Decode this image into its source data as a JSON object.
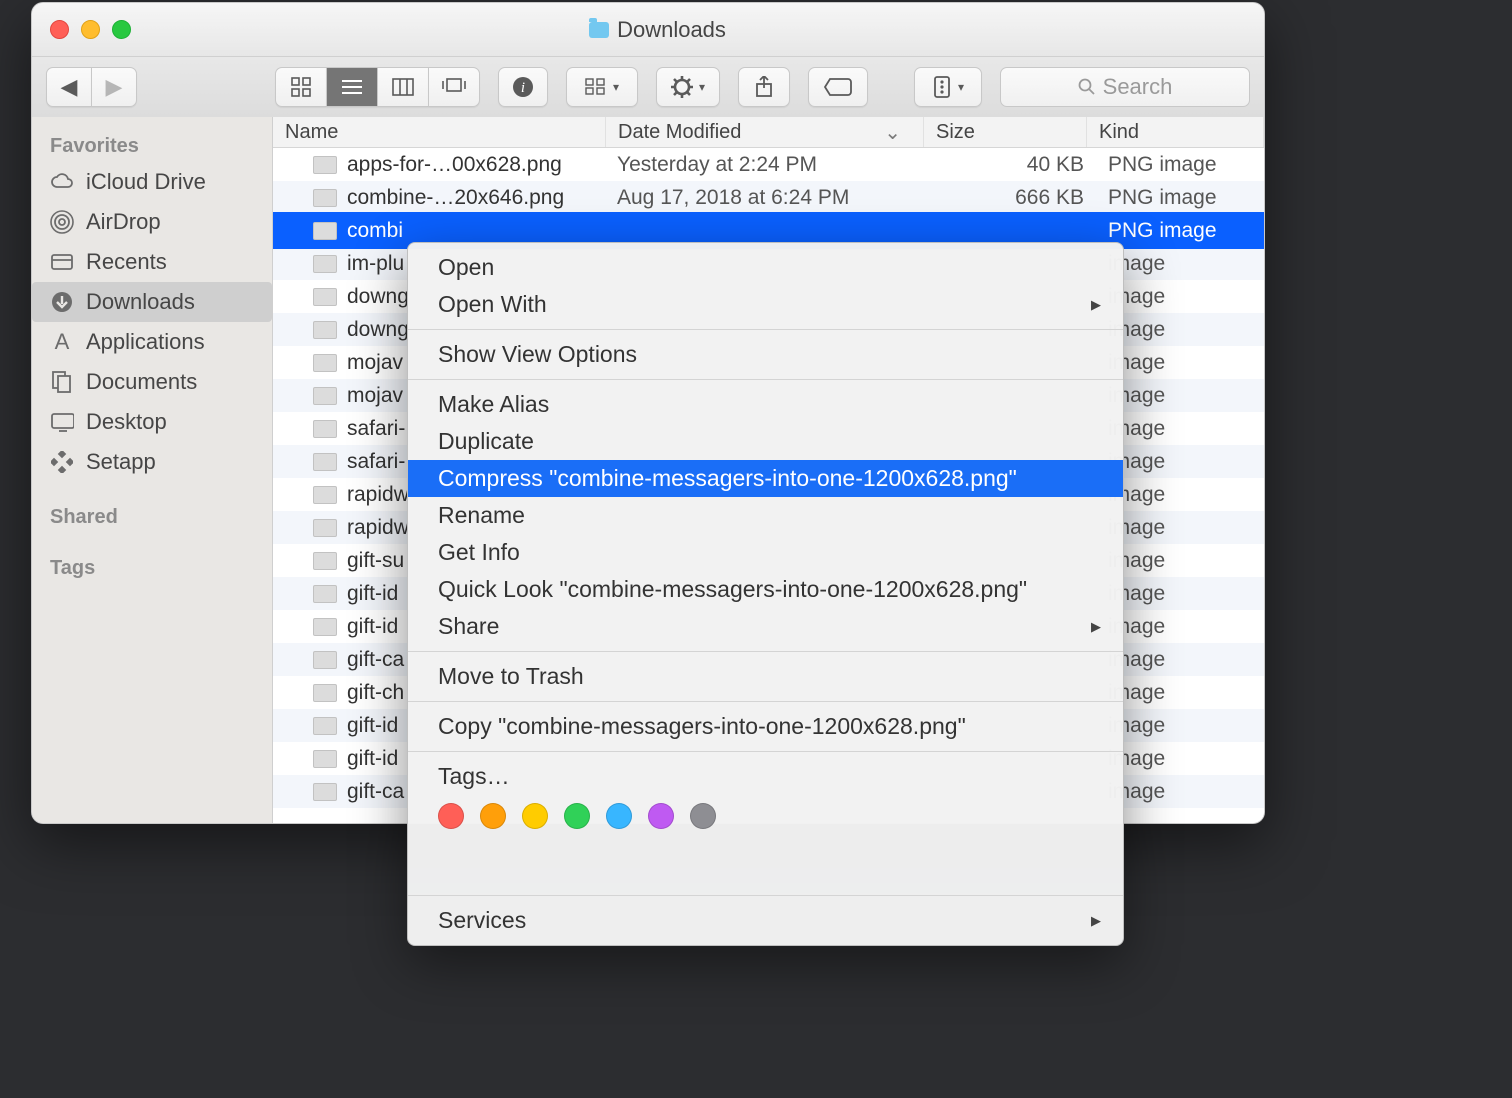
{
  "window": {
    "title": "Downloads"
  },
  "search": {
    "placeholder": "Search"
  },
  "columns": {
    "name": "Name",
    "date": "Date Modified",
    "size": "Size",
    "kind": "Kind"
  },
  "sidebar": {
    "favorites_label": "Favorites",
    "shared_label": "Shared",
    "tags_label": "Tags",
    "items": [
      {
        "label": "iCloud Drive",
        "icon": "cloud"
      },
      {
        "label": "AirDrop",
        "icon": "airdrop"
      },
      {
        "label": "Recents",
        "icon": "recents"
      },
      {
        "label": "Downloads",
        "icon": "downloads",
        "selected": true
      },
      {
        "label": "Applications",
        "icon": "apps"
      },
      {
        "label": "Documents",
        "icon": "docs"
      },
      {
        "label": "Desktop",
        "icon": "desktop"
      },
      {
        "label": "Setapp",
        "icon": "setapp"
      }
    ]
  },
  "rows": [
    {
      "name": "apps-for-…00x628.png",
      "date": "Yesterday at 2:24 PM",
      "size": "40 KB",
      "kind": "PNG image"
    },
    {
      "name": "combine-…20x646.png",
      "date": "Aug 17, 2018 at 6:24 PM",
      "size": "666 KB",
      "kind": "PNG image"
    },
    {
      "name": "combi",
      "kind": "PNG image",
      "selected": true
    },
    {
      "name": "im-plu",
      "kind": "image"
    },
    {
      "name": "downg",
      "kind": "image"
    },
    {
      "name": "downg",
      "kind": "image"
    },
    {
      "name": "mojav",
      "kind": "image"
    },
    {
      "name": "mojav",
      "kind": "image"
    },
    {
      "name": "safari-",
      "kind": "image"
    },
    {
      "name": "safari-",
      "kind": "image"
    },
    {
      "name": "rapidw",
      "kind": "image"
    },
    {
      "name": "rapidw",
      "kind": "image"
    },
    {
      "name": "gift-su",
      "kind": "image"
    },
    {
      "name": "gift-id",
      "kind": "image"
    },
    {
      "name": "gift-id",
      "kind": "image"
    },
    {
      "name": "gift-ca",
      "kind": "image"
    },
    {
      "name": "gift-ch",
      "kind": "image"
    },
    {
      "name": "gift-id",
      "kind": "image"
    },
    {
      "name": "gift-id",
      "kind": "image"
    },
    {
      "name": "gift-ca",
      "kind": "image"
    }
  ],
  "menu": {
    "open": "Open",
    "open_with": "Open With",
    "show_view": "Show View Options",
    "make_alias": "Make Alias",
    "duplicate": "Duplicate",
    "compress": "Compress \"combine-messagers-into-one-1200x628.png\"",
    "rename": "Rename",
    "get_info": "Get Info",
    "quick_look": "Quick Look \"combine-messagers-into-one-1200x628.png\"",
    "share": "Share",
    "move_trash": "Move to Trash",
    "copy": "Copy \"combine-messagers-into-one-1200x628.png\"",
    "tags": "Tags…",
    "services": "Services"
  },
  "tag_colors": [
    "#ff5f57",
    "#ff9f0a",
    "#ffcc00",
    "#30d158",
    "#38b6ff",
    "#bf5af2",
    "#8e8e93"
  ]
}
